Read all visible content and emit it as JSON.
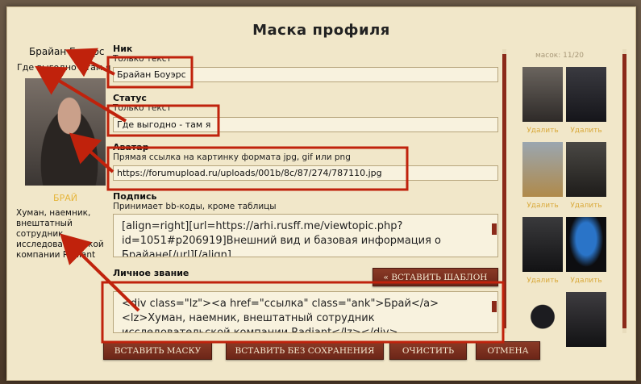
{
  "title": "Маска профиля",
  "preview": {
    "nick": "Брайан Боуэрс",
    "status": "Где выгодно - там я",
    "name": "БРАЙ",
    "desc": "Хуман, наемник, внештатный сотрудник исследовательской компании Radiant"
  },
  "form": {
    "nick_label": "Ник",
    "nick_hint": "Только текст",
    "nick_value": "Брайан Боуэрс",
    "status_label": "Статус",
    "status_hint": "Только текст",
    "status_value": "Где выгодно - там я",
    "avatar_label": "Аватар",
    "avatar_hint": "Прямая ссылка на картинку формата jpg, gif или png",
    "avatar_value": "https://forumupload.ru/uploads/001b/8c/87/274/787110.jpg",
    "signature_label": "Подпись",
    "signature_hint": "Принимает bb-коды, кроме таблицы",
    "signature_value": "[align=right][url=https://arhi.rusff.me/viewtopic.php?id=1051#p206919]Внешний вид и базовая информация о Брайане[/url][/align]",
    "rank_label": "Личное звание",
    "rank_value": "<div class=\"lz\"><a href=\"ссылка\" class=\"ank\">Брай</a><lz>Хуман, наемник, внештатный сотрудник исследовательской компании Radiant</lz></div>",
    "insert_template_label": "« ВСТАВИТЬ ШАБЛОН"
  },
  "buttons": {
    "insert_mask": "ВСТАВИТЬ МАСКУ",
    "insert_no_save": "ВСТАВИТЬ БЕЗ СОХРАНЕНИЯ",
    "clear": "ОЧИСТИТЬ",
    "cancel": "ОТМЕНА"
  },
  "masks": {
    "count_label": "масок: 11/20",
    "delete_label": "Удалить",
    "items": [
      {
        "icon": "portrait-soldier"
      },
      {
        "icon": "portrait-man-dark"
      },
      {
        "icon": "portrait-mech-figure"
      },
      {
        "icon": "portrait-armored-man"
      },
      {
        "icon": "portrait-tactical-man"
      },
      {
        "icon": "portrait-blue-parrot"
      },
      {
        "icon": "portrait-dark-creature"
      },
      {
        "icon": "portrait-armored-suit"
      }
    ]
  },
  "colors": {
    "accent": "#8b2a1a",
    "annotation": "#c0220c",
    "panel": "#f1e7c9",
    "gold": "#e6b53a"
  }
}
